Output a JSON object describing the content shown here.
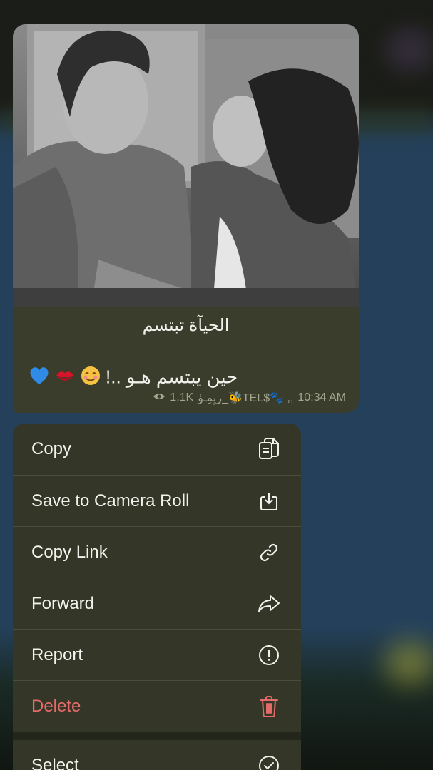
{
  "message": {
    "caption_line1": "الحيآة تبتسم",
    "caption_line2": "حين يبتسم هـو ..!",
    "emojis": [
      "blue-heart",
      "kiss-mark",
      "smiling-face"
    ],
    "views": "1.1K",
    "author": "رﻳِﻤِـﯛ_🐝TEL$🐾 ,,",
    "time": "10:34 AM"
  },
  "menu": {
    "items": [
      {
        "label": "Copy",
        "icon": "copy-icon"
      },
      {
        "label": "Save to Camera Roll",
        "icon": "save-icon"
      },
      {
        "label": "Copy Link",
        "icon": "link-icon"
      },
      {
        "label": "Forward",
        "icon": "forward-icon"
      },
      {
        "label": "Report",
        "icon": "report-icon"
      },
      {
        "label": "Delete",
        "icon": "trash-icon"
      },
      {
        "label": "Select",
        "icon": "checkmark-circle-icon"
      }
    ]
  },
  "colors": {
    "bubble": "#3a3c2c",
    "menu": "#343727",
    "danger": "#e56a6a",
    "text": "#f3f3ee",
    "meta": "#a4a690"
  }
}
